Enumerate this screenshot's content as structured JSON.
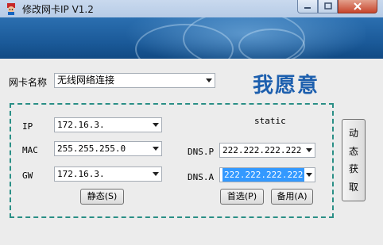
{
  "window": {
    "title": "修改网卡IP V1.2"
  },
  "nic": {
    "label": "网卡名称",
    "selected": "无线网络连接"
  },
  "slogan": "我愿意",
  "mode_text": "static",
  "fields": {
    "ip": {
      "label": "IP",
      "value": "172.16.3."
    },
    "mac": {
      "label": "MAC",
      "value": "255.255.255.0"
    },
    "gw": {
      "label": "GW",
      "value": "172.16.3."
    },
    "dns_primary": {
      "label": "DNS.P",
      "value": "222.222.222.222"
    },
    "dns_alternate": {
      "label": "DNS.A",
      "value": "222.222.222.222"
    }
  },
  "buttons": {
    "static": "静态(S)",
    "preferred": "首选(P)",
    "alternate": "备用(A)",
    "dynamic": [
      "动",
      "态",
      "获",
      "取"
    ]
  },
  "colors": {
    "slogan": "#1d5fae",
    "group_border": "#2a8f86",
    "selection": "#3399ff"
  }
}
